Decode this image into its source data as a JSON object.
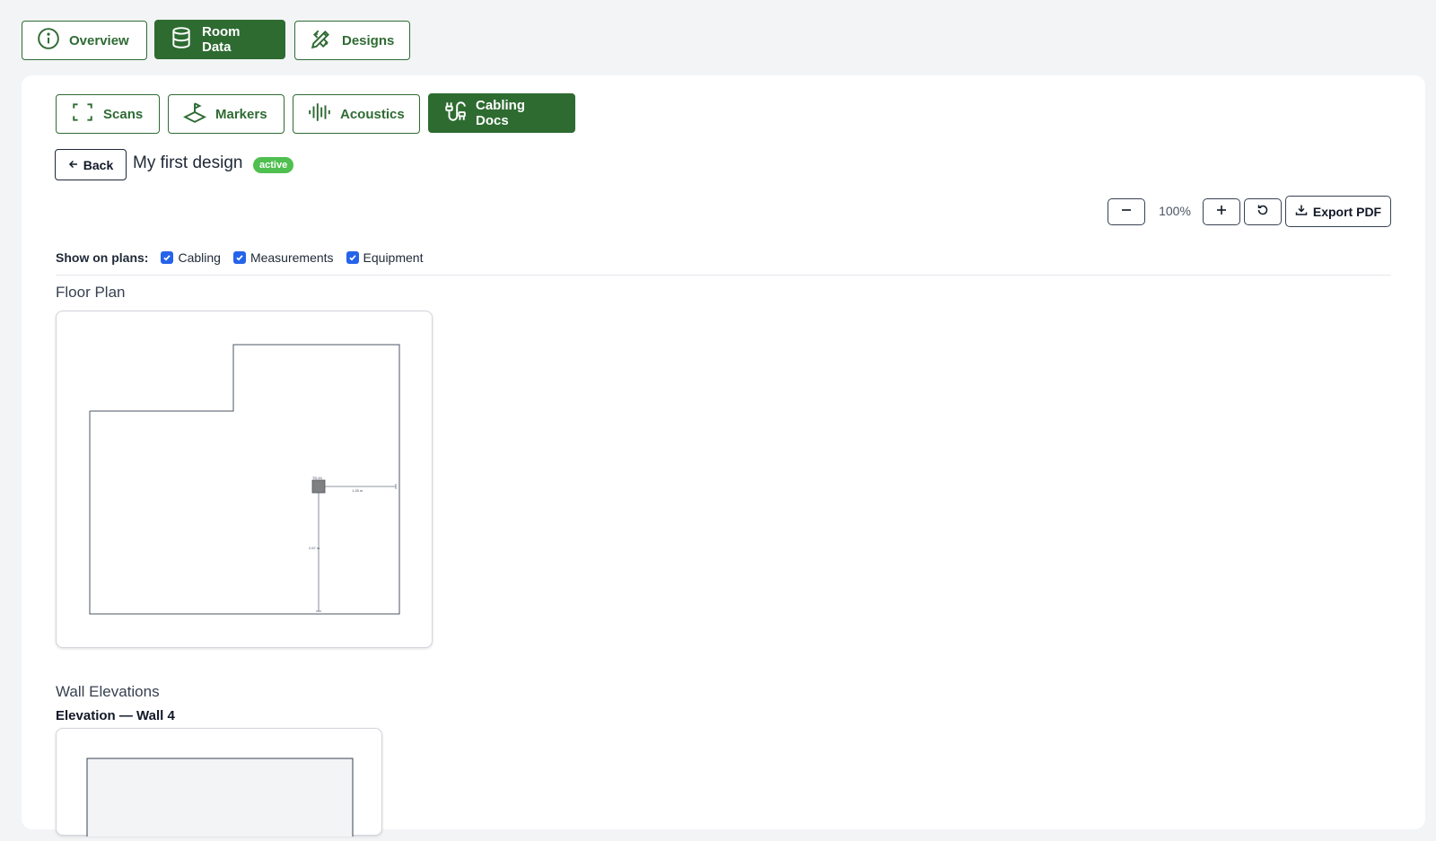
{
  "top_tabs": [
    {
      "label": "Overview",
      "icon": "info-icon",
      "active": false
    },
    {
      "label": "Room Data",
      "icon": "database-icon",
      "active": true
    },
    {
      "label": "Designs",
      "icon": "design-tools-icon",
      "active": false
    }
  ],
  "sub_tabs": [
    {
      "label": "Scans",
      "icon": "scan-icon",
      "active": false
    },
    {
      "label": "Markers",
      "icon": "marker-icon",
      "active": false
    },
    {
      "label": "Acoustics",
      "icon": "audio-waveform-icon",
      "active": false
    },
    {
      "label": "Cabling Docs",
      "icon": "cable-icon",
      "active": true
    }
  ],
  "design": {
    "back_label": "Back",
    "title": "My first design",
    "status": "active"
  },
  "zoom": {
    "level": "100%",
    "export_label": "Export PDF"
  },
  "show_on_plans": {
    "label": "Show on plans:",
    "options": [
      {
        "label": "Cabling",
        "checked": true
      },
      {
        "label": "Measurements",
        "checked": true
      },
      {
        "label": "Equipment",
        "checked": true
      }
    ]
  },
  "floor_plan": {
    "title": "Floor Plan",
    "equipment_label": "TD-01",
    "measure_horizontal": "1.28 m",
    "measure_vertical": "2.67 m"
  },
  "wall_elevations": {
    "title": "Wall Elevations",
    "items": [
      {
        "title": "Elevation — Wall 4"
      }
    ]
  },
  "colors": {
    "brand_green": "#2e6b31",
    "badge_green": "#4fbf4f",
    "checkbox_blue": "#2563eb",
    "page_bg": "#f3f4f6"
  }
}
